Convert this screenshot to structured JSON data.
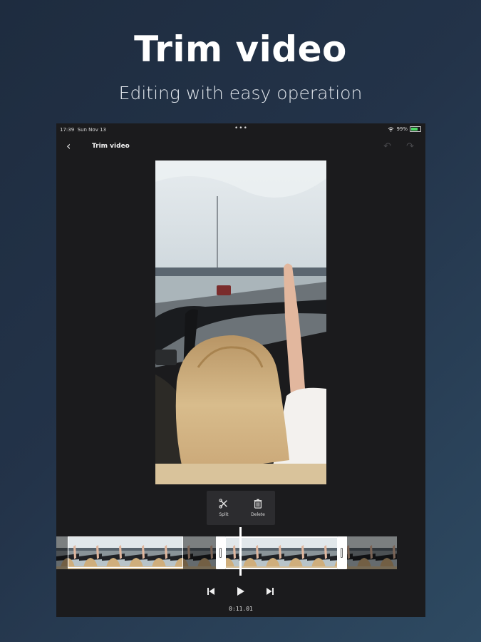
{
  "promo": {
    "headline": "Trim video",
    "subheadline": "Editing with easy operation"
  },
  "status_bar": {
    "time": "17:39",
    "date": "Sun Nov 13",
    "battery": "99%",
    "wifi_icon": "wifi-icon",
    "battery_icon": "battery-icon"
  },
  "app_bar": {
    "title": "Trim video",
    "back_icon": "chevron-left-icon",
    "undo_icon": "undo-icon",
    "redo_icon": "redo-icon",
    "undo_enabled": false,
    "redo_enabled": false
  },
  "tools": [
    {
      "label": "Split",
      "icon": "scissors-icon"
    },
    {
      "label": "Delete",
      "icon": "trash-icon"
    }
  ],
  "playback": {
    "current_time": "0:11.01",
    "previous_icon": "skip-previous-icon",
    "play_icon": "play-icon",
    "next_icon": "skip-next-icon"
  },
  "colors": {
    "background_top": "#1e2c3f",
    "background_bottom": "#2e4a62",
    "device": "#1b1b1d",
    "panel": "#2c2c2f",
    "battery": "#4cd964"
  }
}
